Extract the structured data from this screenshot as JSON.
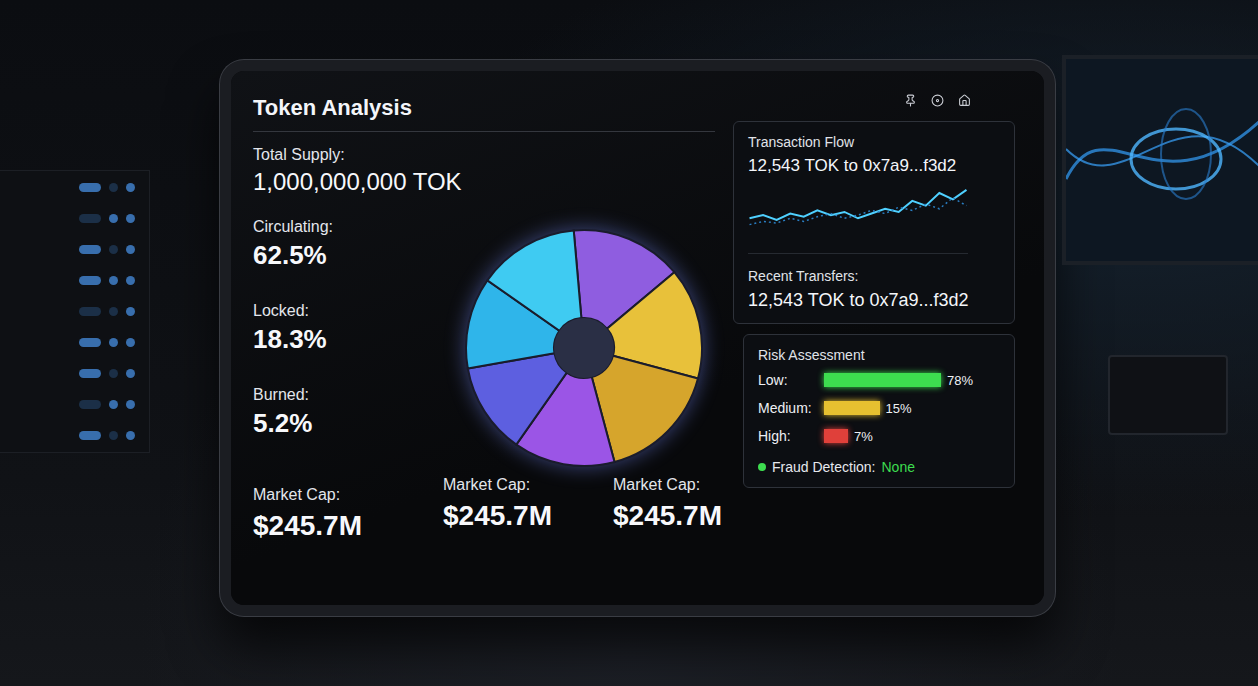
{
  "screen": {
    "title": "Token Analysis"
  },
  "stats": [
    {
      "label": "Total Supply:",
      "value": "1,000,000,000 TOK"
    },
    {
      "label": "Circulating:",
      "value": "62.5%"
    },
    {
      "label": "Locked:",
      "value": "18.3%"
    },
    {
      "label": "Burned:",
      "value": "5.2%"
    }
  ],
  "distribution_chart": {
    "segments": [
      {
        "value": 55,
        "color": "#8f5de0"
      },
      {
        "value": 55,
        "color": "#e8c13a"
      },
      {
        "value": 60,
        "color": "#d6a52c"
      },
      {
        "value": 50,
        "color": "#9b55e6"
      },
      {
        "value": 45,
        "color": "#5d5fe0"
      },
      {
        "value": 45,
        "color": "#2fb5ea"
      },
      {
        "value": 50,
        "color": "#3fcbf2"
      }
    ]
  },
  "market_caps": [
    {
      "label": "Market Cap:",
      "value": "$245.7M"
    },
    {
      "label": "Market Cap:",
      "value": "$245.7M"
    },
    {
      "label": "Market Cap:",
      "value": "$245.7M"
    }
  ],
  "transaction_flow": {
    "title": "Transaction Flow",
    "transfer": "12,543 TOK to 0x7a9...f3d2",
    "series": [
      {
        "values": [
          22,
          24,
          21,
          25,
          23,
          27,
          24,
          26,
          22,
          25,
          28,
          26,
          33,
          30,
          38,
          34,
          40
        ],
        "color": "#4fd0ff"
      },
      {
        "values": [
          18,
          20,
          19,
          22,
          20,
          23,
          25,
          22,
          24,
          27,
          25,
          29,
          27,
          31,
          28,
          35,
          30
        ],
        "color": "#2a7fc4"
      }
    ],
    "recent_label": "Recent Transfers:",
    "recent_transfer": "12,543 TOK to 0x7a9...f3d2"
  },
  "risk_assessment": {
    "title": "Risk Assessment",
    "levels": [
      {
        "label": "Low:",
        "reading": "78%",
        "level": 0.78,
        "color": "#3ddc4f"
      },
      {
        "label": "Medium:",
        "reading": "15%",
        "level": 0.37,
        "color": "#e6c030"
      },
      {
        "label": "High:",
        "reading": "7%",
        "level": 0.16,
        "color": "#e0403a"
      }
    ],
    "fraud_detection": {
      "label": "Fraud Detection:",
      "value": "None",
      "color": "#3ddc4f"
    }
  }
}
